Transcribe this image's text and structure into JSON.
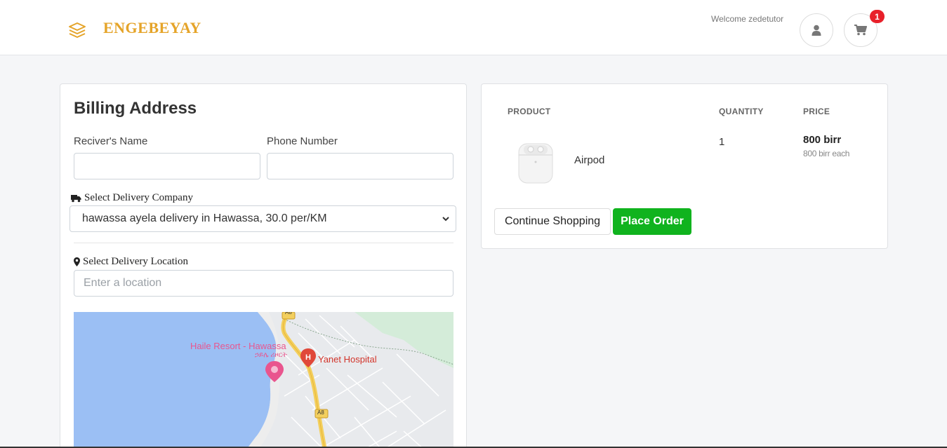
{
  "header": {
    "brand": "ENGEBEYAY",
    "welcome": "Welcome zedetutor",
    "cart_count": "1",
    "colors": {
      "brand": "#e5a429",
      "badge": "#e8202a"
    }
  },
  "billing": {
    "title": "Billing Address",
    "receiver_label": "Reciver's Name",
    "receiver_value": "",
    "phone_label": "Phone Number",
    "phone_value": "",
    "company_label": "Select Delivery Company",
    "company_selected": "hawassa ayela delivery in Hawassa, 30.0 per/KM",
    "location_label": "Select Delivery Location",
    "location_placeholder": "Enter a location"
  },
  "map": {
    "resort_label": "Haile Resort - Hawassa",
    "resort_sublabel": "ኃይሌ ሪዞርት",
    "hospital_label": "Yanet Hospital",
    "road_label_top": "A8",
    "road_label_bottom": "A8"
  },
  "order": {
    "columns": {
      "product": "PRODUCT",
      "quantity": "QUANTITY",
      "price": "PRICE"
    },
    "items": [
      {
        "name": "Airpod",
        "quantity": "1",
        "price": "800 birr",
        "price_each": "800 birr each"
      }
    ],
    "continue_label": "Continue Shopping",
    "place_order_label": "Place Order",
    "colors": {
      "place_order": "#10b31e"
    }
  }
}
